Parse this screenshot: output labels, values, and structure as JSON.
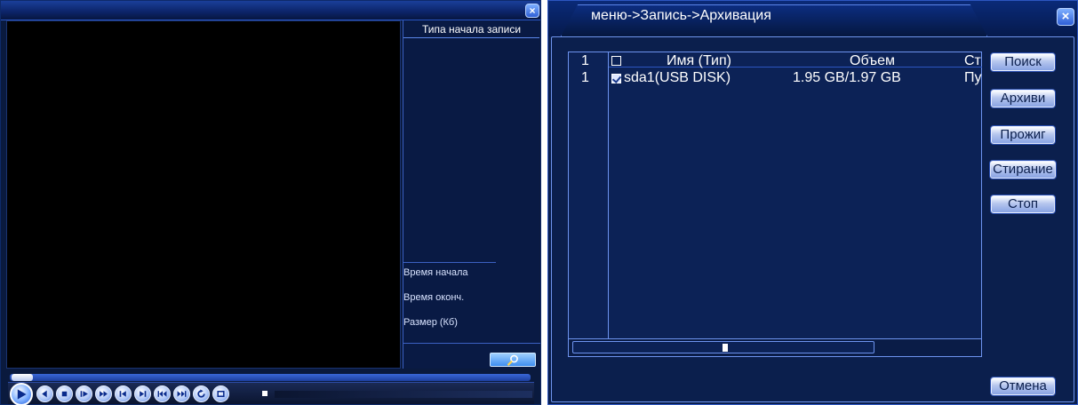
{
  "playback_window": {
    "close_symbol": "×",
    "side_panel": {
      "header": "Типа начала записи",
      "start_time_label": "Время начала",
      "end_time_label": "Время оконч.",
      "size_label": "Размер (Кб)"
    },
    "controls": [
      {
        "icon": "play-icon"
      },
      {
        "icon": "rewind-icon"
      },
      {
        "icon": "stop-icon"
      },
      {
        "icon": "slow-play-icon"
      },
      {
        "icon": "fast-forward-icon"
      },
      {
        "icon": "prev-frame-icon"
      },
      {
        "icon": "next-frame-icon"
      },
      {
        "icon": "prev-file-icon"
      },
      {
        "icon": "next-file-icon"
      },
      {
        "icon": "refresh-icon"
      },
      {
        "icon": "fullscreen-icon"
      }
    ]
  },
  "backup_window": {
    "title": "меню->Запись->Архивация",
    "close_symbol": "×",
    "table": {
      "header": {
        "index": "1",
        "name": "Имя (Тип)",
        "size": "Объем",
        "status": "Ст"
      },
      "rows": [
        {
          "index": "1",
          "checked": true,
          "name": "sda1(USB DISK)",
          "size": "1.95 GB/1.97 GB",
          "status": "Пу"
        }
      ]
    },
    "buttons": {
      "search": "Поиск",
      "archive": "Архиви",
      "burn": "Прожиг",
      "erase": "Стирание",
      "stop": "Стоп",
      "cancel": "Отмена"
    }
  }
}
